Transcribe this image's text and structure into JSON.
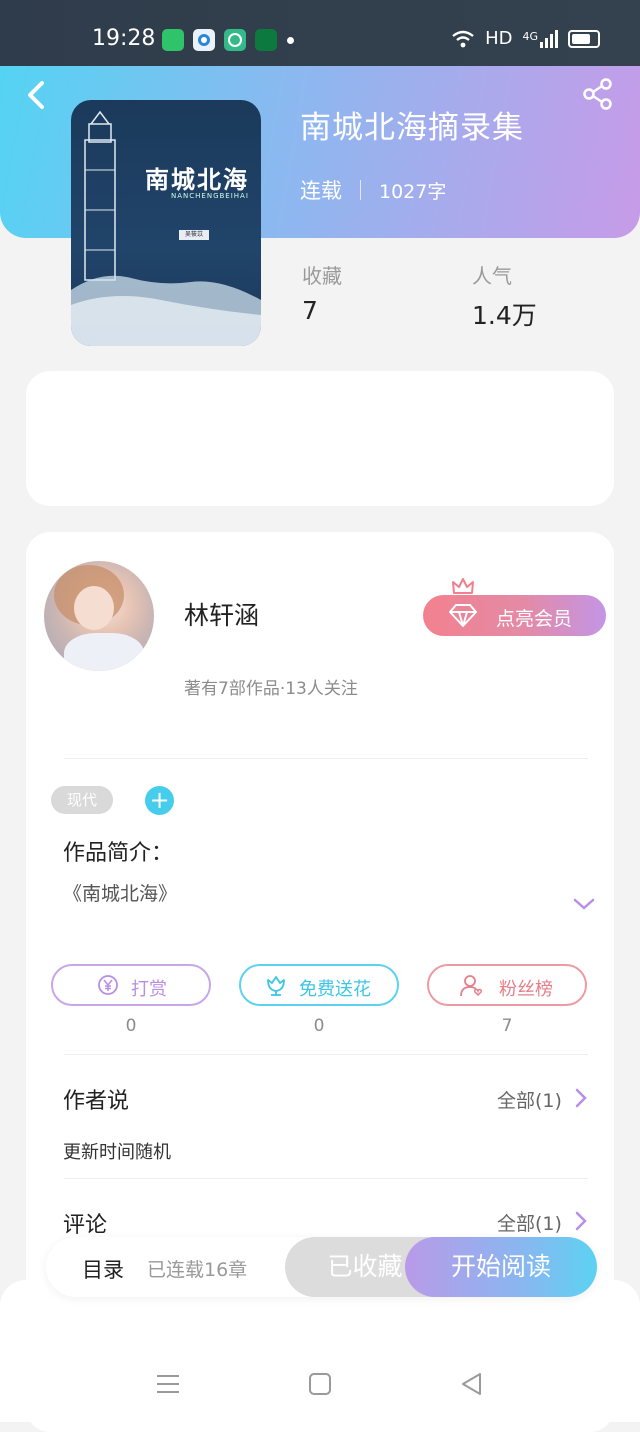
{
  "status_bar": {
    "time": "19:28",
    "network": "HD",
    "signal": "4G"
  },
  "header": {
    "title": "南城北海摘录集",
    "status": "连载",
    "word_count": "1027字"
  },
  "cover": {
    "title": "南城北海",
    "pinyin": "NANCHENGBEIHAI",
    "author_stamp": "吴筱苡"
  },
  "stats": {
    "favorites_label": "收藏",
    "favorites_value": "7",
    "popularity_label": "人气",
    "popularity_value": "1.4万"
  },
  "author": {
    "name": "林轩涵",
    "summary": "著有7部作品·13人关注",
    "vip_label": "点亮会员"
  },
  "tags": {
    "genre": "现代",
    "add": "+"
  },
  "intro": {
    "title": "作品简介：",
    "text": "《南城北海》"
  },
  "actions": [
    {
      "label": "打赏",
      "count": "0"
    },
    {
      "label": "免费送花",
      "count": "0"
    },
    {
      "label": "粉丝榜",
      "count": "7"
    }
  ],
  "author_says": {
    "title": "作者说",
    "all": "全部(1)",
    "content": "更新时间随机"
  },
  "comments": {
    "title": "评论",
    "all": "全部(1)"
  },
  "bottom": {
    "toc": "目录",
    "chapters": "已连载16章",
    "favorited": "已收藏",
    "read": "开始阅读"
  },
  "colors": {
    "accent_cyan": "#46cdec",
    "accent_purple": "#b98fe6",
    "accent_pink": "#f0808f"
  }
}
